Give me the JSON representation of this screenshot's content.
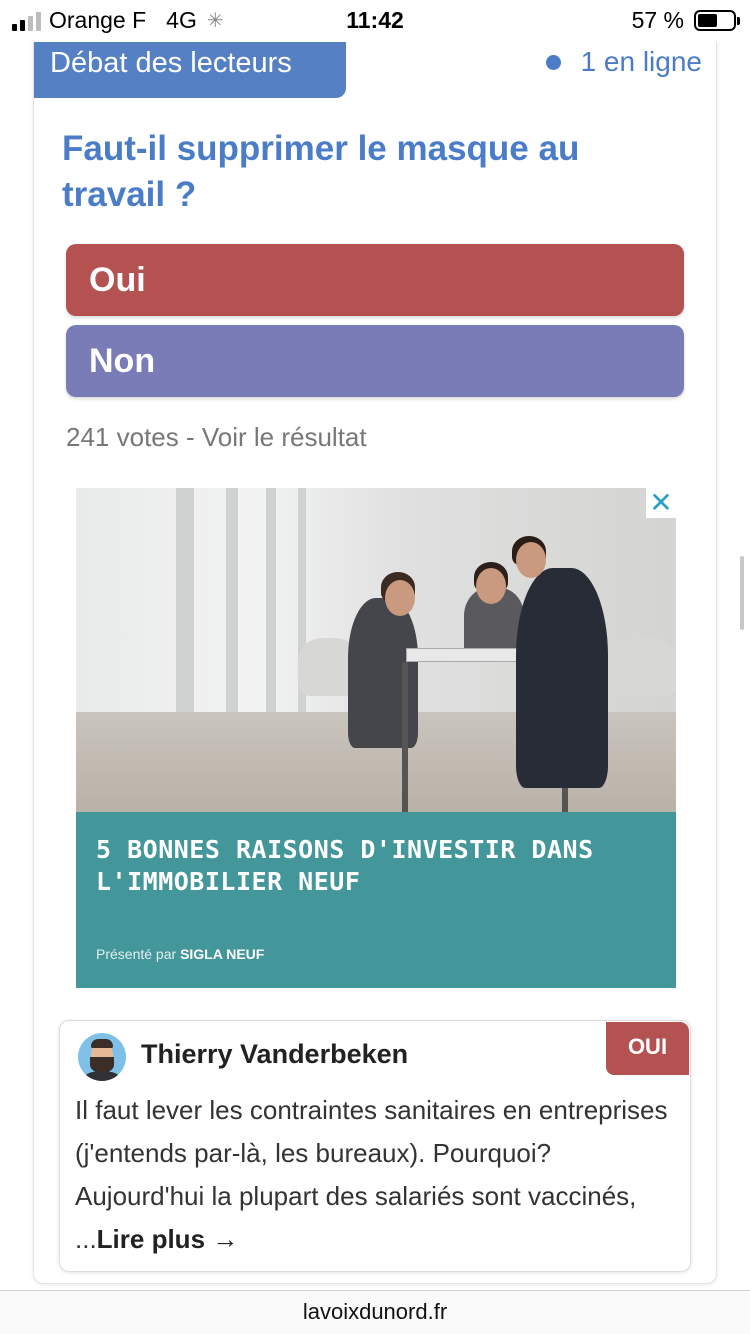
{
  "status_bar": {
    "carrier": "Orange F",
    "network": "4G",
    "time": "11:42",
    "battery_percent_label": "57 %",
    "battery_level": 0.57,
    "signal_bars_active": 2,
    "signal_bars_total": 4
  },
  "debate": {
    "tab_label": "Débat des lecteurs",
    "online_label": "1 en ligne",
    "question": "Faut-il supprimer le masque au travail ?",
    "options": [
      {
        "label": "Oui",
        "color": "#b45252"
      },
      {
        "label": "Non",
        "color": "#7a7cb7"
      }
    ],
    "votes_count": "241 votes",
    "separator": " - ",
    "results_link": "Voir le résultat"
  },
  "ad": {
    "close_icon": "close-icon",
    "headline_line1": "5 BONNES RAISONS D'INVESTIR DANS",
    "headline_line2": "L'IMMOBILIER NEUF",
    "sponsor_prefix": "Présenté par",
    "sponsor_name": "SIGLA NEUF",
    "banner_color": "#43969a"
  },
  "comment": {
    "author": "Thierry Vanderbeken",
    "badge": "OUI",
    "badge_color": "#b45252",
    "text": "Il faut lever les contraintes sanitaires en entreprises (j'entends par-là, les bureaux). Pourquoi? Aujourd'hui la plupart des salariés sont vaccinés, ...",
    "read_more": "Lire plus",
    "read_more_icon": "arrow-right-icon"
  },
  "browser": {
    "domain": "lavoixdunord.fr"
  }
}
